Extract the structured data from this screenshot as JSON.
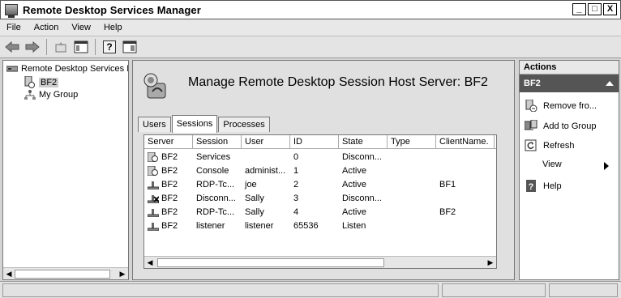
{
  "window": {
    "title": "Remote Desktop Services Manager",
    "buttons": [
      "_",
      "□",
      "X"
    ]
  },
  "menu": [
    "File",
    "Action",
    "View",
    "Help"
  ],
  "tree": {
    "root": "Remote Desktop Services M",
    "server": "BF2",
    "group": "My Group"
  },
  "center": {
    "title": "Manage Remote Desktop Session Host Server: BF2",
    "tabs": [
      "Users",
      "Sessions",
      "Processes"
    ],
    "active_tab": "Sessions",
    "columns": [
      "Server",
      "Session",
      "User",
      "ID",
      "State",
      "Type",
      "ClientName."
    ],
    "rows": [
      {
        "server": "BF2",
        "session": "Services",
        "user": "",
        "id": "0",
        "state": "Disconn...",
        "type": "",
        "client": "",
        "icon": "server-console-icon"
      },
      {
        "server": "BF2",
        "session": "Console",
        "user": "administ...",
        "id": "1",
        "state": "Active",
        "type": "",
        "client": "",
        "icon": "server-console-icon"
      },
      {
        "server": "BF2",
        "session": "RDP-Tc...",
        "user": "joe",
        "id": "2",
        "state": "Active",
        "type": "",
        "client": "BF1",
        "icon": "network-session-icon"
      },
      {
        "server": "BF2",
        "session": "Disconn...",
        "user": "Sally",
        "id": "3",
        "state": "Disconn...",
        "type": "",
        "client": "",
        "icon": "disconnected-session-icon"
      },
      {
        "server": "BF2",
        "session": "RDP-Tc...",
        "user": "Sally",
        "id": "4",
        "state": "Active",
        "type": "",
        "client": "BF2",
        "icon": "network-session-icon"
      },
      {
        "server": "BF2",
        "session": "listener",
        "user": "listener",
        "id": "65536",
        "state": "Listen",
        "type": "",
        "client": "",
        "icon": "listener-icon"
      }
    ]
  },
  "actions": {
    "header": "Actions",
    "section": "BF2",
    "items": [
      {
        "label": "Remove fro...",
        "icon": "remove-from-group-icon"
      },
      {
        "label": "Add to Group",
        "icon": "add-to-group-icon"
      },
      {
        "label": "Refresh",
        "icon": "refresh-icon"
      },
      {
        "label": "View",
        "icon": ""
      },
      {
        "label": "Help",
        "icon": "help-icon"
      }
    ]
  }
}
